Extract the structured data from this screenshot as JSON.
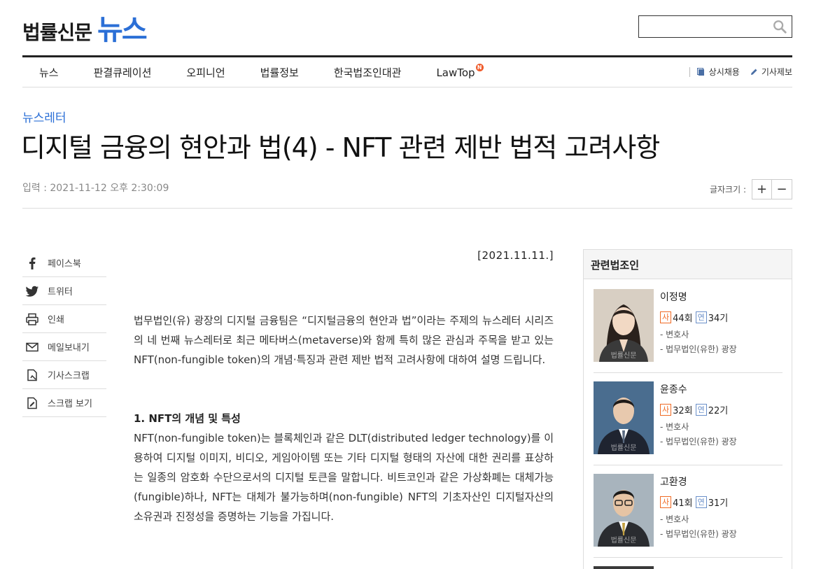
{
  "header": {
    "logo_main": "법률신문",
    "logo_sub": "뉴스",
    "search_placeholder": ""
  },
  "nav": {
    "items": [
      "뉴스",
      "판결큐레이션",
      "오피니언",
      "법률정보",
      "한국법조인대관",
      "LawTop"
    ],
    "lawtop_badge": "N",
    "util": [
      "상시채용",
      "기사제보"
    ]
  },
  "article": {
    "category": "뉴스레터",
    "title": "디지털 금융의 현안과 법(4) - NFT 관련 제반 법적 고려사항",
    "input_date": "입력 : 2021-11-12 오후 2:30:09",
    "fontsize_label": "글자크기 :",
    "fontsize_plus": "+",
    "fontsize_minus": "−",
    "body_date": "[2021.11.11.]",
    "para1": "법무법인(유) 광장의 디지털 금융팀은 “디지털금융의 현안과 법”이라는 주제의 뉴스레터 시리즈의 네 번째 뉴스레터로 최근 메타버스(metaverse)와 함께 특히 많은 관심과 주목을 받고 있는 NFT(non-fungible token)의 개념·특징과 관련 제반 법적 고려사항에 대하여 설명 드립니다.",
    "section1": "1. NFT의 개념 및 특성",
    "para2": "NFT(non-fungible token)는 블록체인과 같은 DLT(distributed ledger technology)를 이용하여 디지털 이미지, 비디오, 게임아이템 또는 기타 디지털 형태의 자산에 대한 권리를 표상하는 일종의 암호화 수단으로서의 디지털 토큰을 말합니다. 비트코인과 같은 가상화폐는 대체가능(fungible)하나, NFT는 대체가 불가능하며(non-fungible) NFT의 기초자산인 디지털자산의 소유권과 진정성을 증명하는 기능을 가집니다."
  },
  "share": {
    "items": [
      "페이스북",
      "트위터",
      "인쇄",
      "메일보내기",
      "기사스크랩",
      "스크랩 보기"
    ]
  },
  "sidebar": {
    "title": "관련법조인",
    "lawyers": [
      {
        "name": "이정명",
        "sa_tag": "사",
        "sa": "44회",
        "yeon_tag": "연",
        "yeon": "34기",
        "role": "- 변호사",
        "firm": "- 법무법인(유한) 광장"
      },
      {
        "name": "윤종수",
        "sa_tag": "사",
        "sa": "32회",
        "yeon_tag": "연",
        "yeon": "22기",
        "role": "- 변호사",
        "firm": "- 법무법인(유한) 광장"
      },
      {
        "name": "고환경",
        "sa_tag": "사",
        "sa": "41회",
        "yeon_tag": "연",
        "yeon": "31기",
        "role": "- 변호사",
        "firm": "- 법무법인(유한) 광장"
      }
    ],
    "watermark": "법률신문"
  },
  "colors": {
    "brand_blue": "#2b6fd6",
    "accent_orange": "#ef6a23",
    "yeon_blue": "#6a8fc9"
  }
}
